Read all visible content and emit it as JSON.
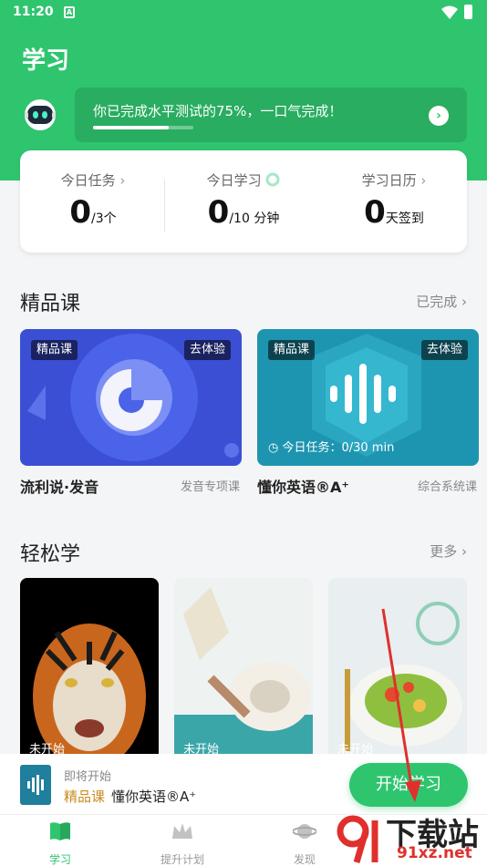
{
  "status": {
    "time": "11:20",
    "a_icon": "A"
  },
  "header": {
    "title": "学习",
    "banner_text": "你已完成水平测试的75%，一口气完成！",
    "banner_progress": 0.75
  },
  "stats": [
    {
      "label": "今日任务",
      "value": "0",
      "unit": "/3个"
    },
    {
      "label": "今日学习",
      "value": "0",
      "unit": "/10 分钟"
    },
    {
      "label": "学习日历",
      "value": "0",
      "unit": "天签到"
    }
  ],
  "premium": {
    "title": "精品课",
    "more": "已完成",
    "cards": [
      {
        "tag": "精品课",
        "action": "去体验",
        "name": "流利说·发音",
        "sub": "发音专项课"
      },
      {
        "tag": "精品课",
        "action": "去体验",
        "name": "懂你英语®A⁺",
        "sub": "综合系统课",
        "task": "今日任务：0/30 min"
      }
    ]
  },
  "easy": {
    "title": "轻松学",
    "more": "更多",
    "items": [
      {
        "status": "未开始",
        "icon": "tiger-photo"
      },
      {
        "status": "未开始",
        "icon": "reading-photo"
      },
      {
        "status": "未开始",
        "icon": "salad-photo"
      }
    ]
  },
  "mini_player": {
    "title": "即将开始",
    "tag": "精品课",
    "course": "懂你英语®A⁺",
    "button": "开始学习"
  },
  "nav": [
    {
      "label": "学习",
      "icon": "book-icon",
      "active": true
    },
    {
      "label": "提升计划",
      "icon": "crown-icon",
      "active": false
    },
    {
      "label": "发现",
      "icon": "planet-icon",
      "active": false
    }
  ],
  "watermark": {
    "text": "下载站",
    "url": "91xz.net"
  },
  "colors": {
    "brand": "#2fc56f",
    "premium_tag": "#c98b1e"
  }
}
